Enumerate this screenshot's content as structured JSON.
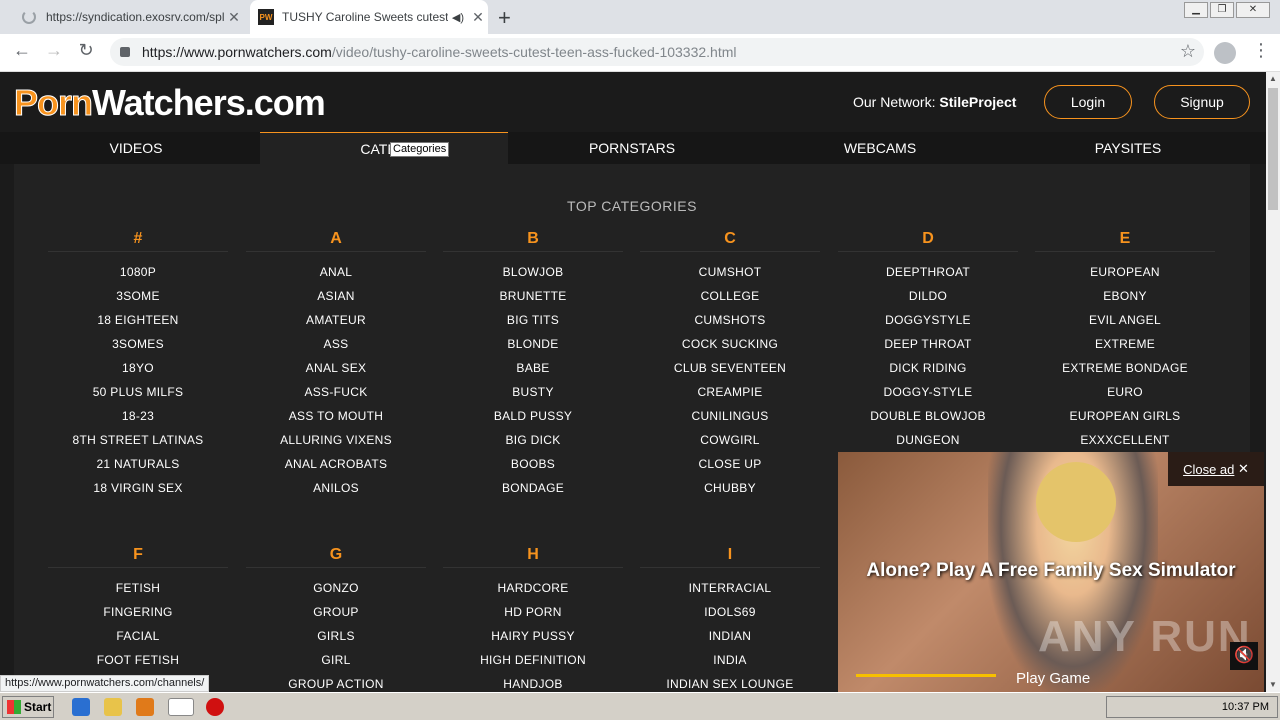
{
  "browser": {
    "tabs": [
      {
        "title": "https://syndication.exosrv.com/spla",
        "state": "loading"
      },
      {
        "title": "TUSHY Caroline Sweets cutest t",
        "state": "active",
        "favicon": "PW"
      }
    ],
    "new_tab_label": "+",
    "url_host": "https://www.pornwatchers.com",
    "url_path": "/video/tushy-caroline-sweets-cutest-teen-ass-fucked-103332.html",
    "status_url": "https://www.pornwatchers.com/channels/"
  },
  "site": {
    "logo_part1": "Porn",
    "logo_part2": "Watchers.com",
    "network_label": "Our Network:",
    "network_name": "StileProject",
    "login_label": "Login",
    "signup_label": "Signup",
    "nav": [
      "VIDEOS",
      "CATEG",
      "PORNSTARS",
      "WEBCAMS",
      "PAYSITES"
    ],
    "tooltip": "Categories",
    "top_categories_title": "TOP CATEGORIES"
  },
  "categories_row1": [
    {
      "letter": "#",
      "items": [
        "1080P",
        "3SOME",
        "18 EIGHTEEN",
        "3SOMES",
        "18YO",
        "50 PLUS MILFS",
        "18-23",
        "8TH STREET LATINAS",
        "21 NATURALS",
        "18 VIRGIN SEX"
      ]
    },
    {
      "letter": "A",
      "items": [
        "ANAL",
        "ASIAN",
        "AMATEUR",
        "ASS",
        "ANAL SEX",
        "ASS-FUCK",
        "ASS TO MOUTH",
        "ALLURING VIXENS",
        "ANAL ACROBATS",
        "ANILOS"
      ]
    },
    {
      "letter": "B",
      "items": [
        "BLOWJOB",
        "BRUNETTE",
        "BIG TITS",
        "BLONDE",
        "BABE",
        "BUSTY",
        "BALD PUSSY",
        "BIG DICK",
        "BOOBS",
        "BONDAGE"
      ]
    },
    {
      "letter": "C",
      "items": [
        "CUMSHOT",
        "COLLEGE",
        "CUMSHOTS",
        "COCK SUCKING",
        "CLUB SEVENTEEN",
        "CREAMPIE",
        "CUNILINGUS",
        "COWGIRL",
        "CLOSE UP",
        "CHUBBY"
      ]
    },
    {
      "letter": "D",
      "items": [
        "DEEPTHROAT",
        "DILDO",
        "DOGGYSTYLE",
        "DEEP THROAT",
        "DICK RIDING",
        "DOGGY-STYLE",
        "DOUBLE BLOWJOB",
        "DUNGEON"
      ]
    },
    {
      "letter": "E",
      "items": [
        "EUROPEAN",
        "EBONY",
        "EVIL ANGEL",
        "EXTREME",
        "EXTREME BONDAGE",
        "EURO",
        "EUROPEAN GIRLS",
        "EXXXCELLENT"
      ]
    }
  ],
  "categories_row2": [
    {
      "letter": "F",
      "items": [
        "FETISH",
        "FINGERING",
        "FACIAL",
        "FOOT FETISH"
      ]
    },
    {
      "letter": "G",
      "items": [
        "GONZO",
        "GROUP",
        "GIRLS",
        "GIRL",
        "GROUP ACTION"
      ]
    },
    {
      "letter": "H",
      "items": [
        "HARDCORE",
        "HD PORN",
        "HAIRY PUSSY",
        "HIGH DEFINITION",
        "HANDJOB"
      ]
    },
    {
      "letter": "I",
      "items": [
        "INTERRACIAL",
        "IDOLS69",
        "INDIAN",
        "INDIA",
        "INDIAN SEX LOUNGE"
      ]
    }
  ],
  "ad": {
    "close_label": "Close ad",
    "headline": "Alone? Play A Free Family Sex Simulator",
    "cta": "Play Game",
    "watermark": "ANY RUN"
  },
  "taskbar": {
    "start_label": "Start",
    "clock": "10:37 PM"
  },
  "colors": {
    "accent": "#f7931e",
    "page_bg": "#1b1b1b",
    "panel_bg": "#222222"
  }
}
